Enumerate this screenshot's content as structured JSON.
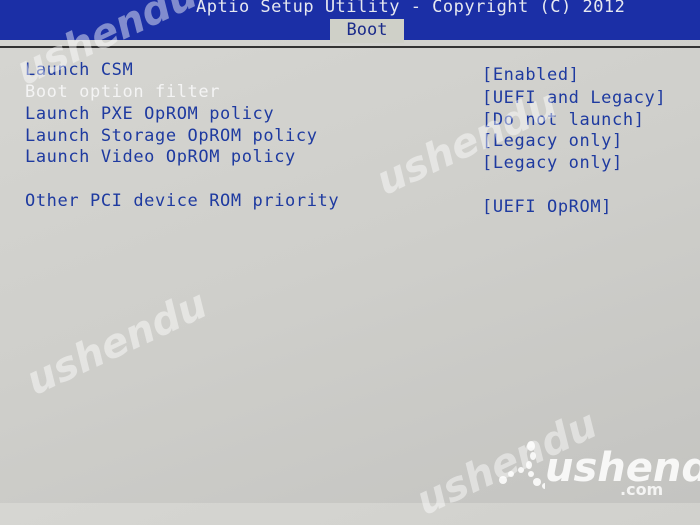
{
  "header": {
    "title": "Aptio Setup Utility - Copyright (C) 2012",
    "active_tab": "Boot"
  },
  "settings": [
    {
      "label": "Launch CSM",
      "value": "[Enabled]",
      "selected": false
    },
    {
      "label": "Boot option filter",
      "value": "[UEFI and Legacy]",
      "selected": true
    },
    {
      "label": "Launch PXE OpROM policy",
      "value": "[Do not launch]",
      "selected": false
    },
    {
      "label": "Launch Storage OpROM policy",
      "value": "[Legacy only]",
      "selected": false
    },
    {
      "label": "Launch Video OpROM policy",
      "value": "[Legacy only]",
      "selected": false
    },
    {
      "label": "Other PCI device ROM priority",
      "value": "[UEFI OpROM]",
      "selected": false
    }
  ],
  "watermark": {
    "brand": "ushendu",
    "suffix": ".com"
  },
  "colors": {
    "header_bg": "#1b2fa6",
    "text": "#1e3aa0",
    "selected_text": "#f4f4f4",
    "body_bg": "#d2d2ce"
  }
}
